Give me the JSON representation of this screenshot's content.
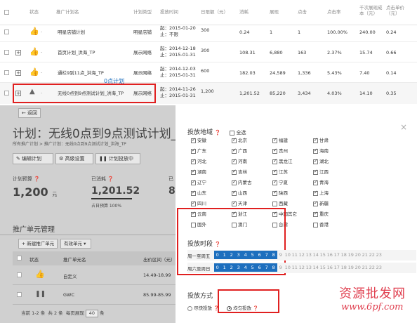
{
  "table": {
    "headers": [
      "状态",
      "推广计划名",
      "计划类型",
      "投放时间",
      "日限额（元）",
      "消耗",
      "展现",
      "点击",
      "点击率",
      "千次展现成本（元）",
      "点击单价（元）"
    ],
    "rows": [
      {
        "name": "明星店铺计划",
        "type": "明星店铺",
        "time1": "起：2015-01-20",
        "time2": "止：不限",
        "budget": "300",
        "cost": "0.24",
        "show": "1",
        "click": "1",
        "ctr": "100.00%",
        "cpm": "240.00",
        "cpc": "0.24"
      },
      {
        "name": "首页计划_洪海_TP",
        "type": "展示网络",
        "time1": "起：2014-12-18",
        "time2": "止：2015-01-31",
        "budget": "300",
        "cost": "108.31",
        "show": "6,880",
        "click": "163",
        "ctr": "2.37%",
        "cpm": "15.74",
        "cpc": "0.66"
      },
      {
        "name": "通栏9到11点_洪海_TP",
        "type": "展示网络",
        "time1": "起：2014-12-03",
        "time2": "止：2015-01-31",
        "budget": "600",
        "cost": "182.03",
        "show": "24,589",
        "click": "1,336",
        "ctr": "5.43%",
        "cpm": "7.40",
        "cpc": "0.14"
      },
      {
        "name": "无线0点到9点测试计划_洪海_TP",
        "type": "展示网络",
        "time1": "起：2014-11-26",
        "time2": "止：2015-01-31",
        "budget": "1,200",
        "cost": "1,201.52",
        "show": "85,220",
        "click": "3,434",
        "ctr": "4.03%",
        "cpm": "14.10",
        "cpc": "0.35"
      }
    ],
    "floating_label": "0点计划"
  },
  "detail": {
    "back": "← 返回",
    "title": "计划：无线0点到9点测试计划_",
    "breadcrumb": "所有推广计划 > 推广计划：无线0点到9点测试计划_洪海_TP",
    "buttons": [
      "编辑计划",
      "高级设置",
      "计划投放中"
    ],
    "budget_label": "计划预算",
    "budget_value": "1,200",
    "budget_unit": "元",
    "spent_label": "已消耗",
    "spent_value": "1,201.52",
    "spent_sub": "占日预算 100%",
    "third_label": "已",
    "third_value": "8",
    "section": "推广单元管理",
    "add_unit": "+ 新建推广单元",
    "valid_unit": "有效单元",
    "col_status": "状态",
    "col_name": "推广单元名",
    "col_price": "出价区间（元）",
    "units": [
      {
        "name": "自定义",
        "price": "14.49-18.99"
      },
      {
        "name": "GWC",
        "price": "85.99-85.99"
      }
    ],
    "footer1": "当前 1-2 条",
    "footer2": "共 2 条",
    "footer3": "每页展现",
    "footer4": "40",
    "footer5": "条"
  },
  "modal": {
    "close": "×",
    "region_title": "投放地域",
    "select_all": "全选",
    "provinces": [
      [
        "安徽",
        "北京",
        "福建",
        "甘肃"
      ],
      [
        "广东",
        "广西",
        "贵州",
        "海南"
      ],
      [
        "河北",
        "河南",
        "黑龙江",
        "湖北"
      ],
      [
        "湖南",
        "吉林",
        "江苏",
        "江西"
      ],
      [
        "辽宁",
        "内蒙古",
        "宁夏",
        "青海"
      ],
      [
        "山东",
        "山西",
        "陕西",
        "上海"
      ],
      [
        "四川",
        "天津",
        "西藏",
        "新疆"
      ],
      [
        "云南",
        "浙江",
        "中国其它",
        "重庆"
      ],
      [
        "国外",
        "澳门",
        "台湾",
        "香港"
      ]
    ],
    "unchecked": [
      "西藏",
      "国外",
      "澳门",
      "台湾",
      "香港"
    ],
    "time_title": "投放时段",
    "weekday_label": "周一至周五",
    "weekend_label": "周六至周日",
    "hours": [
      "0",
      "1",
      "2",
      "3",
      "4",
      "5",
      "6",
      "7",
      "8",
      "9",
      "10",
      "11",
      "12",
      "13",
      "14",
      "15",
      "16",
      "17",
      "18",
      "19",
      "20",
      "21",
      "22",
      "23"
    ],
    "active_hours": 9,
    "mode_title": "投放方式",
    "mode_fast": "尽快投放",
    "mode_even": "均匀投放"
  },
  "watermark": {
    "line1": "资源批发网",
    "line2": "www.6pf.com"
  },
  "colors": {
    "accent": "#1d6fbe",
    "highlight": "#e02020",
    "watermark": "#e04050"
  }
}
